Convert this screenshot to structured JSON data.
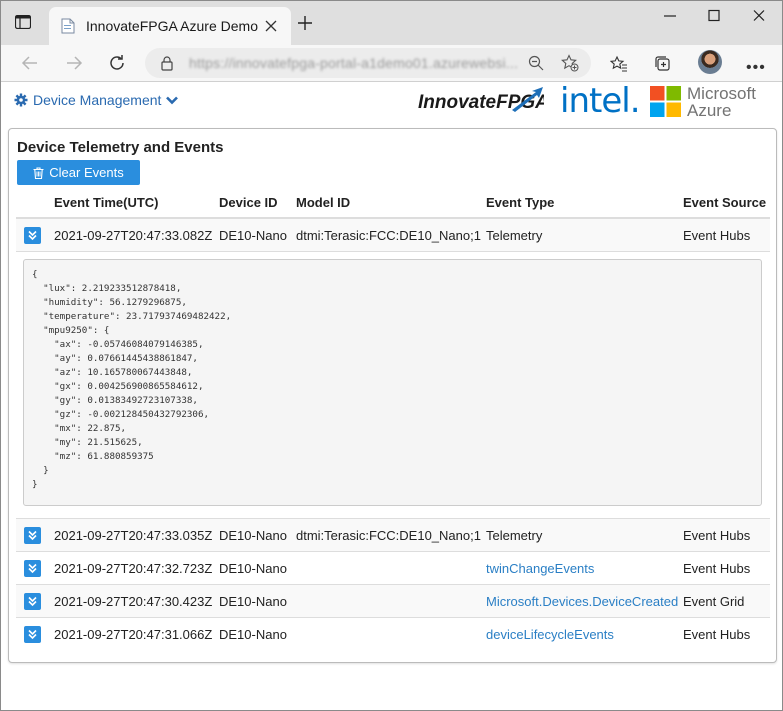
{
  "browser": {
    "tab_title": "InnovateFPGA Azure Demo",
    "url": "https://innovatefpga-portal-a1demo01.azurewebsi..."
  },
  "header": {
    "menu_label": "Device Management",
    "logos": {
      "fpga": "InnovateFPGA",
      "intel": "intel.",
      "microsoft_line1": "Microsoft",
      "microsoft_line2": "Azure"
    }
  },
  "panel": {
    "title": "Device Telemetry and Events",
    "clear_button": "Clear Events",
    "columns": [
      "Event Time(UTC)",
      "Device ID",
      "Model ID",
      "Event Type",
      "Event Source"
    ],
    "rows": [
      {
        "time": "2021-09-27T20:47:33.082Z",
        "device": "DE10-Nano",
        "model": "dtmi:Terasic:FCC:DE10_Nano;1",
        "type": "Telemetry",
        "source": "Event Hubs"
      },
      {
        "time": "2021-09-27T20:47:33.035Z",
        "device": "DE10-Nano",
        "model": "dtmi:Terasic:FCC:DE10_Nano;1",
        "type": "Telemetry",
        "source": "Event Hubs"
      },
      {
        "time": "2021-09-27T20:47:32.723Z",
        "device": "DE10-Nano",
        "model": "",
        "type": "twinChangeEvents",
        "source": "Event Hubs"
      },
      {
        "time": "2021-09-27T20:47:30.423Z",
        "device": "DE10-Nano",
        "model": "",
        "type": "Microsoft.Devices.DeviceCreated",
        "source": "Event Grid"
      },
      {
        "time": "2021-09-27T20:47:31.066Z",
        "device": "DE10-Nano",
        "model": "",
        "type": "deviceLifecycleEvents",
        "source": "Event Hubs"
      }
    ],
    "expanded_json": "{\n  \"lux\": 2.219233512878418,\n  \"humidity\": 56.1279296875,\n  \"temperature\": 23.717937469482422,\n  \"mpu9250\": {\n    \"ax\": -0.05746084079146385,\n    \"ay\": 0.07661445438861847,\n    \"az\": 10.165780067443848,\n    \"gx\": 0.004256900865584612,\n    \"gy\": 0.01383492723107338,\n    \"gz\": -0.002128450432792306,\n    \"mx\": 22.875,\n    \"my\": 21.515625,\n    \"mz\": 61.880859375\n  }\n}"
  }
}
